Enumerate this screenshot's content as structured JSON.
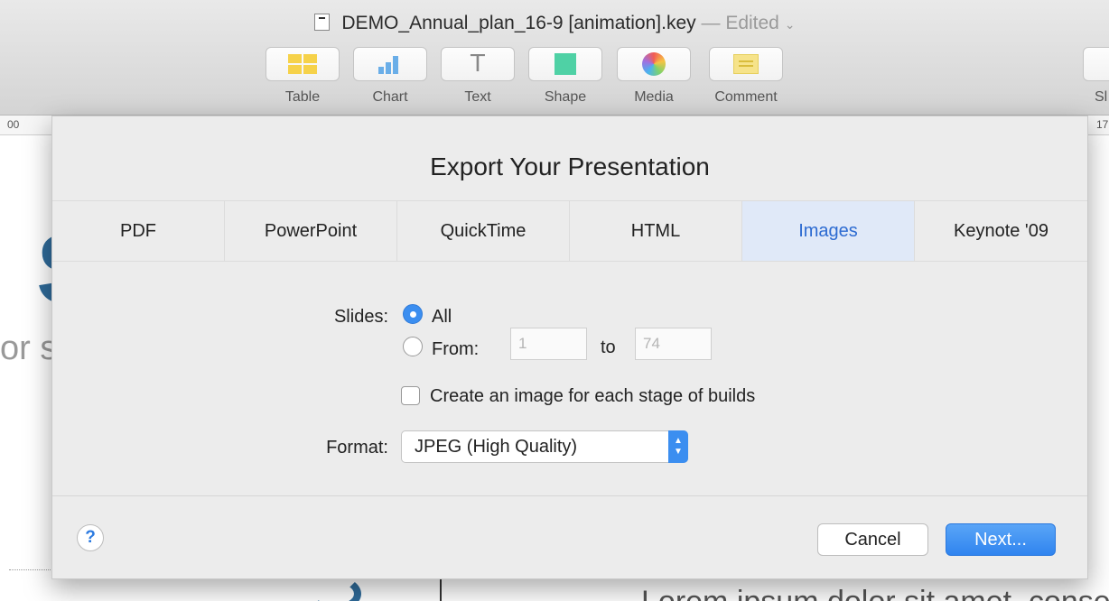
{
  "window": {
    "filename": "DEMO_Annual_plan_16-9 [animation].key",
    "separator": "—",
    "status": "Edited",
    "status_chevron": "⌄"
  },
  "toolbar": {
    "buttons": [
      {
        "label": "Table",
        "icon": "table-icon"
      },
      {
        "label": "Chart",
        "icon": "chart-icon"
      },
      {
        "label": "Text",
        "icon": "text-icon"
      },
      {
        "label": "Shape",
        "icon": "shape-icon"
      },
      {
        "label": "Media",
        "icon": "media-icon"
      },
      {
        "label": "Comment",
        "icon": "comment-icon"
      }
    ],
    "text_glyph": "T",
    "share_label_partial": "Sl"
  },
  "ruler": {
    "left_value": "00",
    "right_value": "17"
  },
  "background": {
    "big_letter": "S",
    "left_text": "or s",
    "lorem": "Lorem ipsum dolor sit amet, conse"
  },
  "dialog": {
    "title": "Export Your Presentation",
    "tabs": [
      {
        "label": "PDF",
        "active": false
      },
      {
        "label": "PowerPoint",
        "active": false
      },
      {
        "label": "QuickTime",
        "active": false
      },
      {
        "label": "HTML",
        "active": false
      },
      {
        "label": "Images",
        "active": true
      },
      {
        "label": "Keynote '09",
        "active": false
      }
    ],
    "slides_label": "Slides:",
    "option_all": "All",
    "option_from": "From:",
    "from_value": "1",
    "to_label": "to",
    "to_value": "74",
    "builds_checkbox_label": "Create an image for each stage of builds",
    "builds_checked": false,
    "format_label": "Format:",
    "format_value": "JPEG (High Quality)",
    "help_glyph": "?",
    "cancel_label": "Cancel",
    "next_label": "Next..."
  },
  "colors": {
    "accent": "#3b8ef0",
    "active_tab_bg": "#e0e9f8",
    "active_tab_text": "#2d6bd1"
  }
}
